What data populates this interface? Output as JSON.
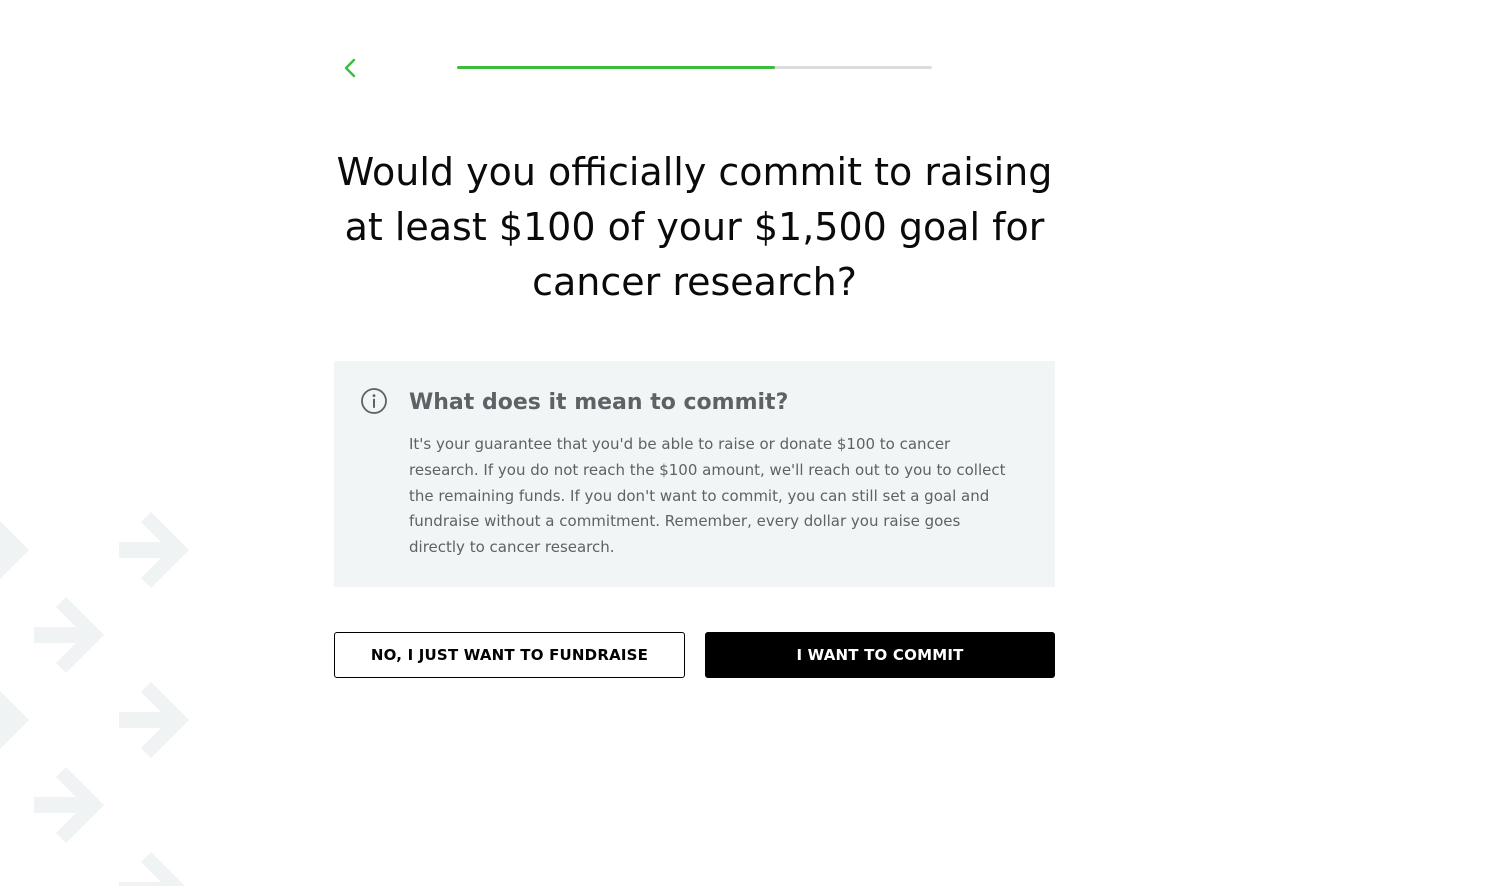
{
  "colors": {
    "accent": "#3cbe3c",
    "track": "#dcdcdc",
    "info_bg": "#f2f5f5",
    "info_text": "#5d6266",
    "primary_button": "#000000",
    "pattern": "#f0f3f3"
  },
  "header": {
    "back_icon": "chevron-left-icon",
    "progress_fraction": 0.67
  },
  "question": {
    "line1": "Would you officially commit to raising",
    "line2": "at least $100 of your $1,500 goal for",
    "line3": "cancer research?"
  },
  "info": {
    "icon": "info-circle-icon",
    "title": "What does it mean to commit?",
    "lines": [
      "It's your guarantee that you'd be able to raise or donate $100 to cancer",
      "research. If you do not reach the $100 amount, we'll reach out to you to collect",
      "the remaining funds. If you don't want to commit, you can still set a goal and",
      "fundraise without a commitment. Remember, every dollar you raise goes",
      "directly to cancer research."
    ]
  },
  "actions": {
    "decline_label": "NO, I JUST WANT TO FUNDRAISE",
    "commit_label": "I WANT TO COMMIT"
  },
  "background": {
    "pattern_icon": "arrow-right-icon"
  }
}
